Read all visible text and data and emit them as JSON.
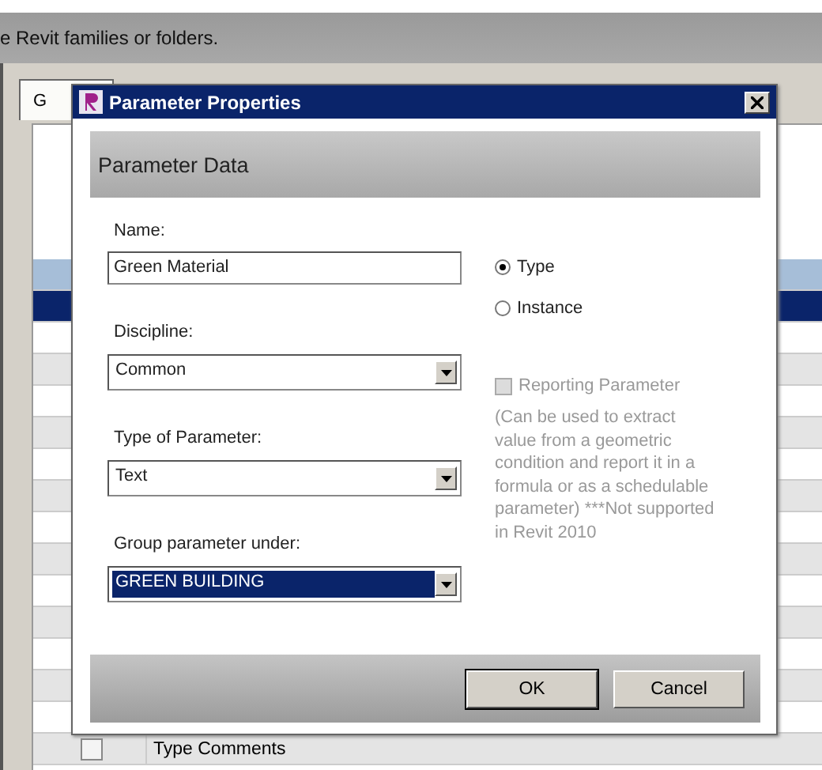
{
  "background_window": {
    "banner": "e Revit families or folders.",
    "tabs": [
      {
        "label": "G",
        "selected": true
      }
    ],
    "rows": [
      {
        "selected": false
      },
      {
        "selected": true
      },
      {
        "selected": false
      },
      {
        "selected": false
      },
      {
        "selected": false
      },
      {
        "selected": false
      },
      {
        "selected": false
      },
      {
        "selected": false
      },
      {
        "selected": false
      },
      {
        "selected": false
      },
      {
        "selected": false
      },
      {
        "selected": false
      },
      {
        "selected": false
      },
      {
        "selected": false
      },
      {
        "selected": false
      },
      {
        "selected": false,
        "checked": false,
        "name": "Type Comments"
      }
    ]
  },
  "dialog": {
    "title": "Parameter Properties",
    "header": "Parameter Data",
    "name_label": "Name:",
    "name_value": "Green Material",
    "discipline_label": "Discipline:",
    "discipline_value": "Common",
    "type_label": "Type of Parameter:",
    "type_value": "Text",
    "group_label": "Group parameter under:",
    "group_value": "GREEN BUILDING",
    "group_highlighted": true,
    "options": [
      {
        "label": "Type",
        "selected": true
      },
      {
        "label": "Instance",
        "selected": false
      }
    ],
    "reporting": {
      "label": "Reporting Parameter",
      "checked": false,
      "disabled": true
    },
    "reporting_note": "(Can be used to extract value from a geometric condition and report it in a formula or as a schedulable parameter) ***Not supported in Revit 2010",
    "buttons": [
      {
        "label": "OK",
        "default": true
      },
      {
        "label": "Cancel",
        "default": false
      }
    ]
  }
}
